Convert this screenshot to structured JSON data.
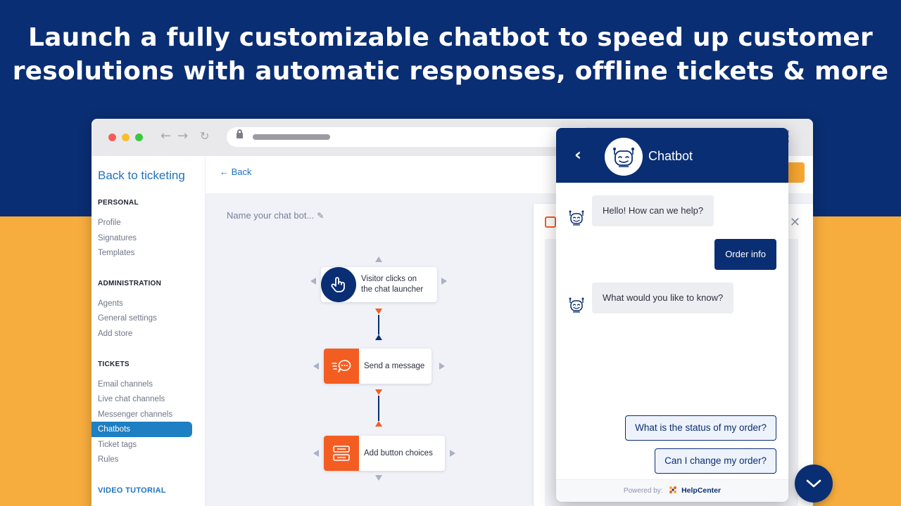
{
  "headline": {
    "line1": "Launch a fully customizable chatbot to speed up customer",
    "line2": "resolutions with automatic responses, offline tickets & more"
  },
  "colors": {
    "navy": "#0a2e73",
    "orange": "#f45d22",
    "amber": "#f7ad3e",
    "link": "#1e73be"
  },
  "sidebar": {
    "back_label": "Back to ticketing",
    "personal_header": "PERSONAL",
    "personal_items": [
      "Profile",
      "Signatures",
      "Templates"
    ],
    "admin_header": "ADMINISTRATION",
    "admin_items": [
      "Agents",
      "General settings",
      "Add store"
    ],
    "tickets_header": "TICKETS",
    "tickets_items": [
      "Email channels",
      "Live chat channels",
      "Messenger channels",
      "Chatbots",
      "Ticket tags",
      "Rules"
    ],
    "active_item": "Chatbots",
    "video_tutorial": "VIDEO TUTORIAL"
  },
  "main": {
    "back_label": "Back",
    "bot_name_placeholder": "Name your chat bot...",
    "nodes": [
      {
        "icon": "hand-pointer-icon",
        "label_line1": "Visitor clicks on",
        "label_line2": "the chat launcher"
      },
      {
        "icon": "message-icon",
        "label": "Send a message"
      },
      {
        "icon": "button-choices-icon",
        "label": "Add button choices"
      }
    ]
  },
  "chat": {
    "title": "Chatbot",
    "messages": [
      {
        "from": "bot",
        "text": "Hello! How can we help?"
      },
      {
        "from": "user",
        "text": "Order info"
      },
      {
        "from": "bot",
        "text": "What would you like to know?"
      }
    ],
    "choices": [
      "What is the status of my order?",
      "Can I change my order?"
    ],
    "footer_prefix": "Powered by:",
    "footer_brand": "HelpCenter"
  }
}
